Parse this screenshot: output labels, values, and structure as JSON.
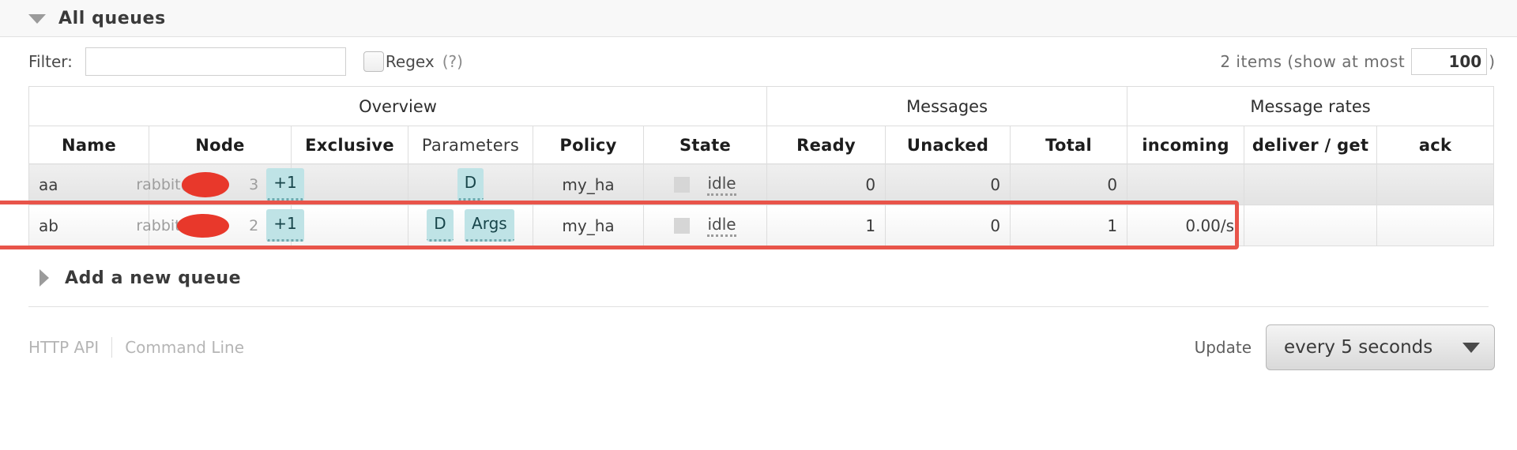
{
  "section": {
    "title": "All queues",
    "collapse_icon": "triangle-down-icon"
  },
  "filter": {
    "label": "Filter:",
    "value": "",
    "placeholder": "",
    "regex_label": "Regex",
    "help_label": "(?)",
    "regex_checked": false
  },
  "paging": {
    "items_text": "2 items (show at most",
    "max_items": "100",
    "close_paren": ")"
  },
  "table": {
    "groups": [
      {
        "label": "Overview",
        "span": 6
      },
      {
        "label": "Messages",
        "span": 3
      },
      {
        "label": "Message rates",
        "span": 3
      }
    ],
    "columns": [
      {
        "label": "Name",
        "bold": true
      },
      {
        "label": "Node",
        "bold": true
      },
      {
        "label": "Exclusive",
        "bold": true
      },
      {
        "label": "Parameters",
        "bold": false
      },
      {
        "label": "Policy",
        "bold": true
      },
      {
        "label": "State",
        "bold": true
      },
      {
        "label": "Ready",
        "bold": true
      },
      {
        "label": "Unacked",
        "bold": true
      },
      {
        "label": "Total",
        "bold": true
      },
      {
        "label": "incoming",
        "bold": true
      },
      {
        "label": "deliver / get",
        "bold": true
      },
      {
        "label": "ack",
        "bold": true
      }
    ],
    "rows": [
      {
        "name": "aa",
        "node_text": "rabbit@",
        "node_suffix": "3",
        "node_extra": "+1",
        "exclusive": "",
        "parameters": [
          "D"
        ],
        "policy": "my_ha",
        "state": "idle",
        "ready": "0",
        "unacked": "0",
        "total": "0",
        "incoming": "",
        "deliver_get": "",
        "ack": ""
      },
      {
        "name": "ab",
        "node_text": "rabbit@",
        "node_suffix": "2",
        "node_extra": "+1",
        "exclusive": "",
        "parameters": [
          "D",
          "Args"
        ],
        "policy": "my_ha",
        "state": "idle",
        "ready": "1",
        "unacked": "0",
        "total": "1",
        "incoming": "0.00/s",
        "deliver_get": "",
        "ack": ""
      }
    ]
  },
  "add_queue": {
    "label": "Add a new queue",
    "expand_icon": "triangle-right-icon"
  },
  "footer": {
    "http_api": "HTTP API",
    "command_line": "Command Line",
    "update_label": "Update",
    "update_value": "every 5 seconds",
    "caret_icon": "chevron-down-icon"
  },
  "colors": {
    "annotation": "#e8544a",
    "redaction": "#e8382b",
    "tag_bg": "#bfe3e6"
  }
}
